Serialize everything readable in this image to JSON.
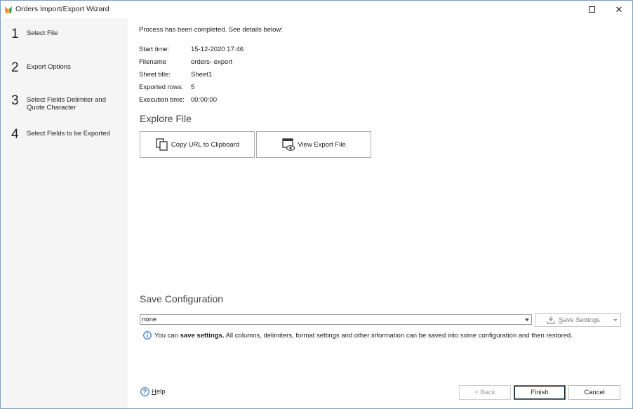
{
  "window": {
    "title": "Orders Import/Export Wizard",
    "icon": "wizard-app-icon",
    "maximize_icon": "maximize-icon",
    "close_icon": "close-icon",
    "close_glyph": "✕"
  },
  "sidebar": {
    "steps": [
      {
        "number": "1",
        "label": "Select File"
      },
      {
        "number": "2",
        "label": "Export Options"
      },
      {
        "number": "3",
        "label": "Select Fields Delimiter and Quote Character"
      },
      {
        "number": "4",
        "label": "Select Fields to be Exported"
      }
    ]
  },
  "main": {
    "status": "Process has been completed. See details below:",
    "details": [
      {
        "key": "Start time:",
        "value": "15-12-2020 17:46"
      },
      {
        "key": "Filename",
        "value": "orders- export"
      },
      {
        "key": "Sheet title:",
        "value": "Sheet1"
      },
      {
        "key": "Exported rows:",
        "value": "5"
      },
      {
        "key": "Execution time:",
        "value": "00:00:00"
      }
    ],
    "explore_title": "Explore File",
    "copy_url_label": "Copy URL to Clipboard",
    "view_file_label": "View Export File",
    "save_config_title": "Save Configuration",
    "config_value": "none",
    "save_settings_label": "Save Settings",
    "save_settings_mnemonic": "S",
    "hint_prefix": "You can ",
    "hint_bold": "save settings.",
    "hint_rest": " All columns, delimiters, format settings and other information can be saved into some configuration and then restored."
  },
  "footer": {
    "help_label": "Help",
    "back_label": "< Back",
    "finish_label": "Finish",
    "cancel_label": "Cancel"
  },
  "colors": {
    "sidebar_bg": "#f5f5f5",
    "info_icon": "#1e6fcf",
    "help_icon": "#2a6fb8",
    "border": "#7a9cc6"
  }
}
